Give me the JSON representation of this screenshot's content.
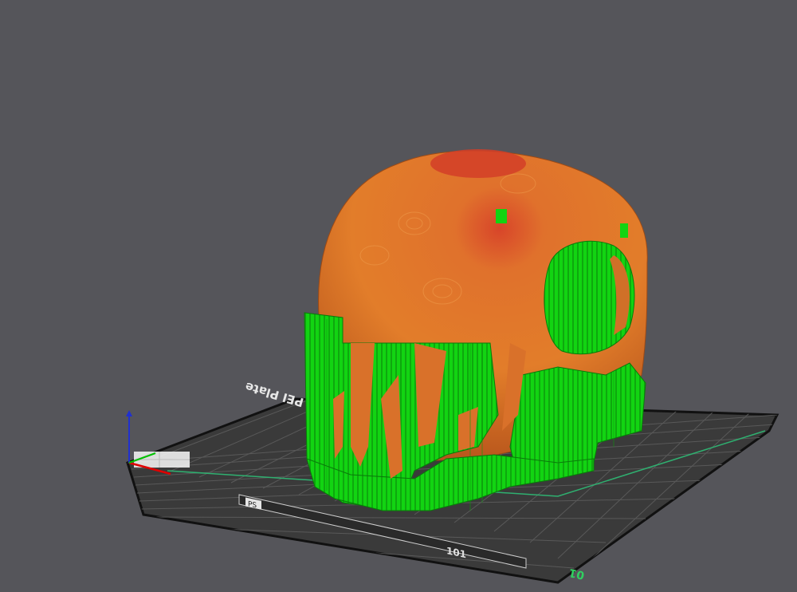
{
  "viewport": {
    "background": "#55555a",
    "plate_label": "PEI Plate",
    "bed_number": "01",
    "logo_text": "PS",
    "corner_text": "101"
  },
  "colors": {
    "bed": "#3a3a3a",
    "bed_grid": "#5a5a5a",
    "bed_edge": "#111111",
    "support": "#10d010",
    "support_dark": "#0a8a0a",
    "model": "#e27d2a",
    "model_shadow": "#b8561c",
    "model_top": "#d8452a",
    "axis_x": "#e00000",
    "axis_y": "#00c000",
    "axis_z": "#2030d0",
    "bed_number_color": "#30d060"
  },
  "icons": {
    "axes": "xyz-axes-icon",
    "logo": "prusa-logo-icon"
  }
}
